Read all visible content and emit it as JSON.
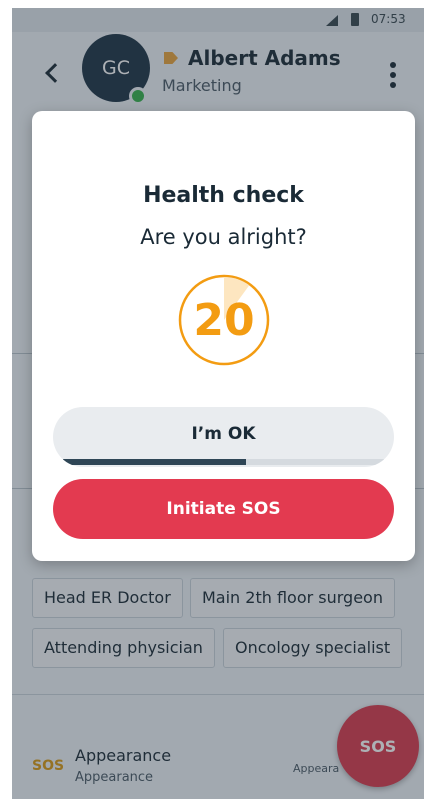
{
  "status_bar": {
    "time": "07:53"
  },
  "header": {
    "avatar_initials": "GC",
    "contact_name": "Albert Adams",
    "department": "Marketing"
  },
  "background": {
    "chips": [
      "Head ER Doctor",
      "Main 2th floor surgeon",
      "Attending physician",
      "Oncology specialist"
    ],
    "bottom": {
      "sos_label": "SOS",
      "appearance_title": "Appearance",
      "appearance_subtitle": "Appearance",
      "appearance_right": "Appeara"
    },
    "fab_label": "SOS"
  },
  "dialog": {
    "title": "Health check",
    "question": "Are you alright?",
    "countdown": "20",
    "countdown_elapsed_fraction": 0.1,
    "ok_label": "I’m OK",
    "ok_progress_fraction": 0.57,
    "sos_label": "Initiate SOS"
  },
  "colors": {
    "accent_orange": "#f39c12",
    "sos_red": "#e33a50",
    "online_green": "#37b24d"
  }
}
